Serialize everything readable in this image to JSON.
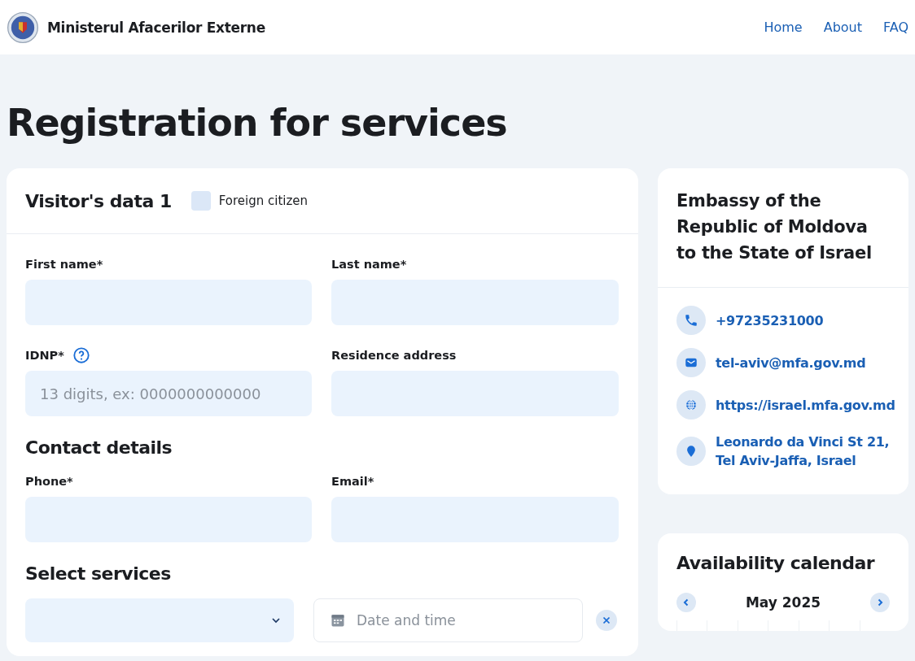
{
  "header": {
    "site_title": "Ministerul Afacerilor Externe",
    "nav": [
      {
        "label": "Home"
      },
      {
        "label": "About"
      },
      {
        "label": "FAQ"
      }
    ]
  },
  "page_title": "Registration for services",
  "form": {
    "title": "Visitor's data 1",
    "foreign_citizen": {
      "label": "Foreign citizen",
      "checked": false
    },
    "fields": [
      {
        "label": "First name*"
      },
      {
        "label": "Last name*"
      },
      {
        "label": "IDNP*",
        "help": true,
        "placeholder": "13 digits, ex: 0000000000000"
      },
      {
        "label": "Residence address"
      }
    ],
    "contact_title": "Contact details",
    "contact_fields": [
      {
        "label": "Phone*"
      },
      {
        "label": "Email*"
      }
    ],
    "services_title": "Select services",
    "date_placeholder": "Date and time"
  },
  "embassy": {
    "title": "Embassy of the Republic of Moldova to the State of Israel",
    "contacts": [
      {
        "kind": "phone",
        "text": "+97235231000"
      },
      {
        "kind": "email",
        "text": "tel-aviv@mfa.gov.md"
      },
      {
        "kind": "web",
        "text": "https://israel.mfa.gov.md"
      },
      {
        "kind": "address",
        "text": "Leonardo da Vinci St 21, Tel Aviv-Jaffa, Israel"
      }
    ]
  },
  "calendar": {
    "title": "Availability calendar",
    "month": "May 2025"
  }
}
